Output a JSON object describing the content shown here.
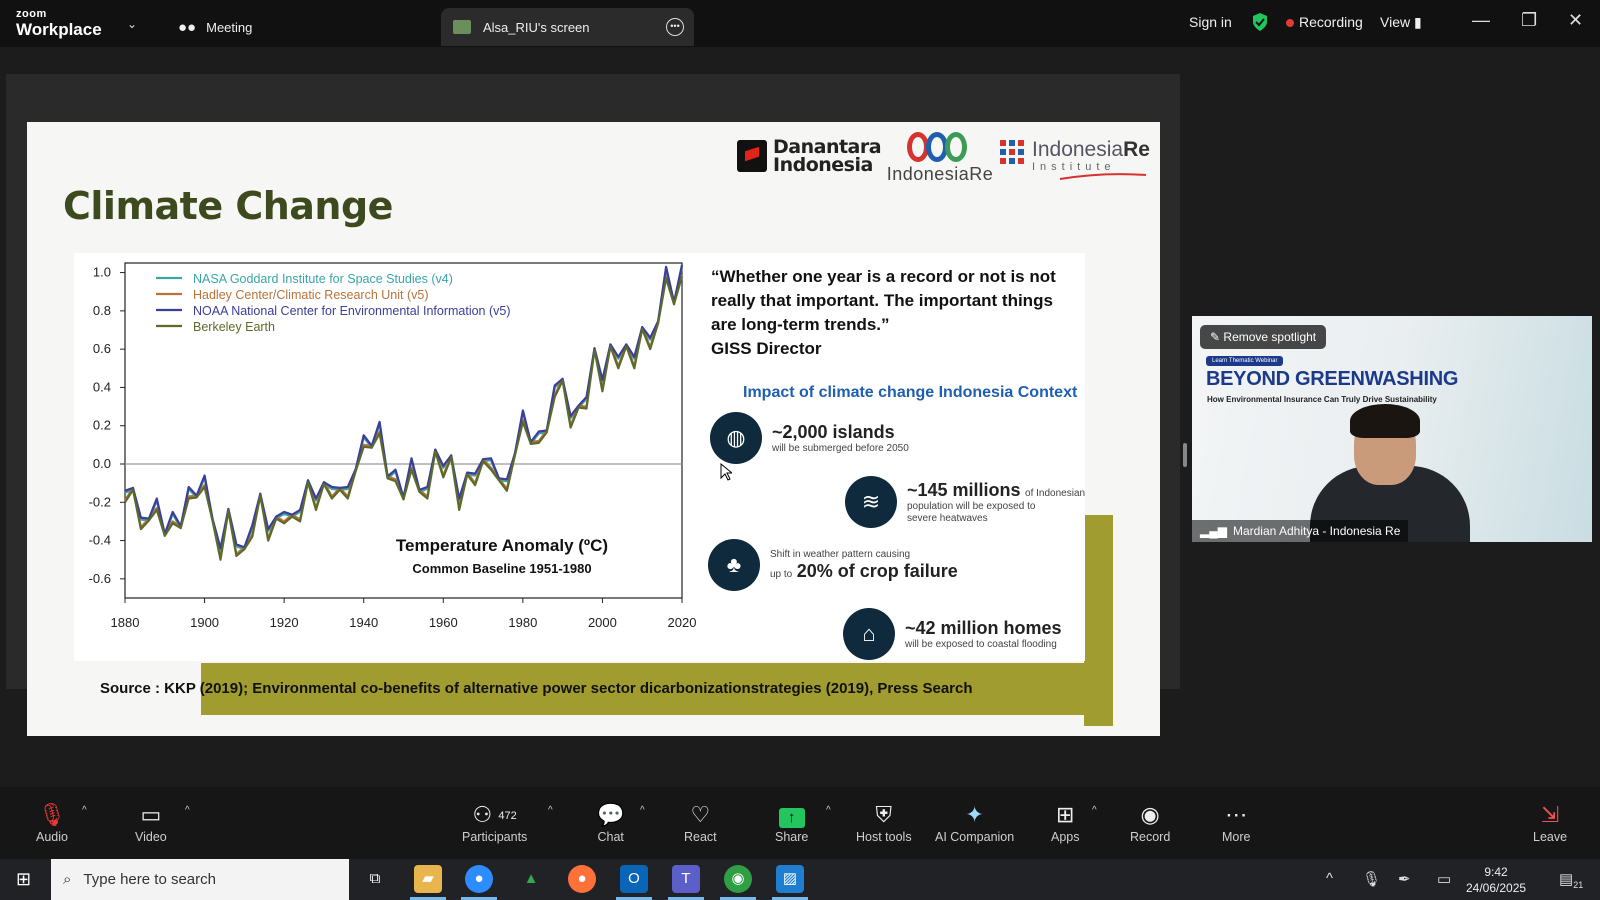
{
  "app": {
    "brand_small": "zoom",
    "brand_main": "Workplace",
    "brand_chevron": "⌄"
  },
  "tabs": {
    "meeting": "Meeting",
    "screen": "Alsa_RIU's screen"
  },
  "top_right": {
    "sign_in": "Sign in",
    "recording": "Recording",
    "view": "View"
  },
  "window_controls": {
    "minimize": "—",
    "restore": "❐",
    "close": "✕"
  },
  "slide": {
    "title": "Climate Change",
    "logos": {
      "danantara_line1": "Danantara",
      "danantara_line2": "Indonesia",
      "indonesia_re": "IndonesiaRe",
      "iri_name": "Indonesia",
      "iri_re": "Re",
      "iri_sub": "Institute"
    },
    "quote": "“Whether one year is a record or not is not really that important. The important things are long-term trends.”",
    "quote_author": "GISS Director",
    "impact_heading": "Impact of climate change Indonesia Context",
    "impacts": [
      {
        "icon": "globe-icon",
        "big": "~2,000 islands",
        "small": "will be submerged before 2050"
      },
      {
        "icon": "waves-icon",
        "big": "~145 millions",
        "small_inline": "of Indonesian",
        "small": "population will be exposed to severe heatwaves"
      },
      {
        "icon": "crop-icon",
        "pre": "Shift in weather pattern causing",
        "pre2": "up to",
        "big": "20% of crop failure"
      },
      {
        "icon": "house-icon",
        "big": "~42 million homes",
        "small": "will be exposed to coastal flooding"
      }
    ],
    "source": "Source : KKP (2019); Environmental co-benefits of alternative power sector dicarbonizationstrategies (2019), Press Search"
  },
  "chart_data": {
    "type": "line",
    "title": "Temperature Anomaly (ºC)",
    "subtitle": "Common Baseline 1951-1980",
    "xlabel": "",
    "ylabel": "",
    "xlim": [
      1880,
      2020
    ],
    "ylim": [
      -0.7,
      1.05
    ],
    "x_ticks": [
      1880,
      1900,
      1920,
      1940,
      1960,
      1980,
      2000,
      2020
    ],
    "y_ticks": [
      1.0,
      0.8,
      0.6,
      0.4,
      0.2,
      0.0,
      -0.2,
      -0.4,
      -0.6
    ],
    "y_tick_labels": [
      "1.0",
      "0.8",
      "0.6",
      "0.4",
      "0.2",
      "0.0",
      "-0.2",
      "-0.4",
      "-0.6"
    ],
    "legend_position": "top-left",
    "series": [
      {
        "name": "NASA Goddard Institute for Space Studies (v4)",
        "color": "#3aa6a6",
        "offset": 0.0
      },
      {
        "name": "Hadley Center/Climatic Research Unit (v5)",
        "color": "#b8733a",
        "offset": -0.02
      },
      {
        "name": "NOAA National Center for Environmental Information (v5)",
        "color": "#3b3f9a",
        "offset": 0.01
      },
      {
        "name": "Berkeley Earth",
        "color": "#5b6b2a",
        "offset": -0.03
      }
    ],
    "x": [
      1880,
      1882,
      1884,
      1886,
      1888,
      1890,
      1892,
      1894,
      1896,
      1898,
      1900,
      1902,
      1904,
      1906,
      1908,
      1910,
      1912,
      1914,
      1916,
      1918,
      1920,
      1922,
      1924,
      1926,
      1928,
      1930,
      1932,
      1934,
      1936,
      1938,
      1940,
      1942,
      1944,
      1946,
      1948,
      1950,
      1952,
      1954,
      1956,
      1958,
      1960,
      1962,
      1964,
      1966,
      1968,
      1970,
      1972,
      1974,
      1976,
      1978,
      1980,
      1982,
      1984,
      1986,
      1988,
      1990,
      1992,
      1994,
      1996,
      1998,
      2000,
      2002,
      2004,
      2006,
      2008,
      2010,
      2012,
      2014,
      2016,
      2018,
      2020
    ],
    "base": [
      -0.16,
      -0.12,
      -0.3,
      -0.28,
      -0.2,
      -0.36,
      -0.27,
      -0.32,
      -0.14,
      -0.16,
      -0.08,
      -0.28,
      -0.46,
      -0.23,
      -0.44,
      -0.43,
      -0.34,
      -0.15,
      -0.36,
      -0.27,
      -0.27,
      -0.26,
      -0.26,
      -0.08,
      -0.2,
      -0.09,
      -0.14,
      -0.12,
      -0.14,
      -0.02,
      0.13,
      0.1,
      0.2,
      -0.06,
      -0.05,
      -0.17,
      0.01,
      -0.13,
      -0.14,
      0.08,
      -0.03,
      0.05,
      -0.2,
      -0.04,
      -0.07,
      0.03,
      0.01,
      -0.07,
      -0.1,
      0.06,
      0.26,
      0.12,
      0.15,
      0.18,
      0.39,
      0.45,
      0.23,
      0.31,
      0.33,
      0.61,
      0.42,
      0.63,
      0.54,
      0.63,
      0.54,
      0.72,
      0.64,
      0.75,
      1.01,
      0.85,
      1.02
    ]
  },
  "video": {
    "spotlight_btn": "Remove spotlight",
    "webinar_tag": "Learn Thematic Webinar",
    "title": "BEYOND GREENWASHING",
    "subtitle": "How Environmental Insurance Can Truly Drive Sustainability",
    "participant": "Mardian Adhitya - Indonesia Re"
  },
  "toolbar": {
    "audio": "Audio",
    "video": "Video",
    "participants": "Participants",
    "participant_count": "472",
    "chat": "Chat",
    "react": "React",
    "share": "Share",
    "host_tools": "Host tools",
    "ai_companion": "AI Companion",
    "apps": "Apps",
    "record": "Record",
    "more": "More",
    "leave": "Leave"
  },
  "taskbar": {
    "search_placeholder": "Type here to search",
    "time": "9:42",
    "date": "24/06/2025",
    "notif_count": "21"
  },
  "colors": {
    "olive": "#a19c2f",
    "title_green": "#3c4a1e",
    "impact_blue": "#1f5fb0"
  }
}
